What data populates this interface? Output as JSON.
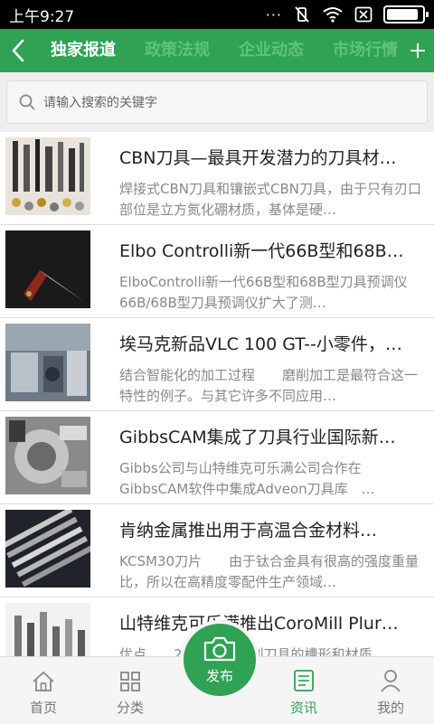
{
  "status": {
    "time": "上午9:27",
    "battery_level": 0.9
  },
  "nav": {
    "tabs": [
      {
        "label": "独家报道",
        "active": true
      },
      {
        "label": "政策法规",
        "active": false
      },
      {
        "label": "企业动态",
        "active": false
      },
      {
        "label": "市场行情",
        "active": false
      }
    ]
  },
  "search": {
    "placeholder": "请输入搜索的关键字"
  },
  "articles": [
    {
      "title": "CBN刀具—最具开发潜力的刀具材…",
      "desc": "焊接式CBN刀具和镶嵌式CBN刀具，由于只有刃口部位是立方氮化硼材质，基体是硬…",
      "image": "tool-holders-and-inserts"
    },
    {
      "title": "Elbo Controlli新一代66B型和68B…",
      "desc": "ElboControlli新一代66B型和68B型刀具预调仪　　66B/68B型刀具预调仪扩大了测…",
      "image": "knife"
    },
    {
      "title": "埃马克新品VLC 100 GT--小零件，…",
      "desc": "结合智能化的加工过程　　磨削加工是最符合这一特性的例子。与其它许多不同应用…",
      "image": "machine-interior"
    },
    {
      "title": "GibbsCAM集成了刀具行业国际新…",
      "desc": "Gibbs公司与山特维克可乐满公司合作在GibbsCAM软件中集成Adveon刀具库　…",
      "image": "lathe-turret"
    },
    {
      "title": "肯纳金属推出用于高温合金材料…",
      "desc": "KCSM30刀片　　由于钛合金具有很高的强度重量比，所以在高精度零配件生产领域…",
      "image": "taps-and-drills"
    },
    {
      "title": "山特维克可乐满推出CoroMill Plur…",
      "desc": "优点　　2系列：该系列刀具的槽形和材质…",
      "image": "end-mills"
    }
  ],
  "bottom_nav": {
    "home": "首页",
    "category": "分类",
    "publish": "发布",
    "news": "资讯",
    "mine": "我的"
  },
  "colors": {
    "brand_green": "#2fa254",
    "inactive_tab": "#5fc27f"
  }
}
